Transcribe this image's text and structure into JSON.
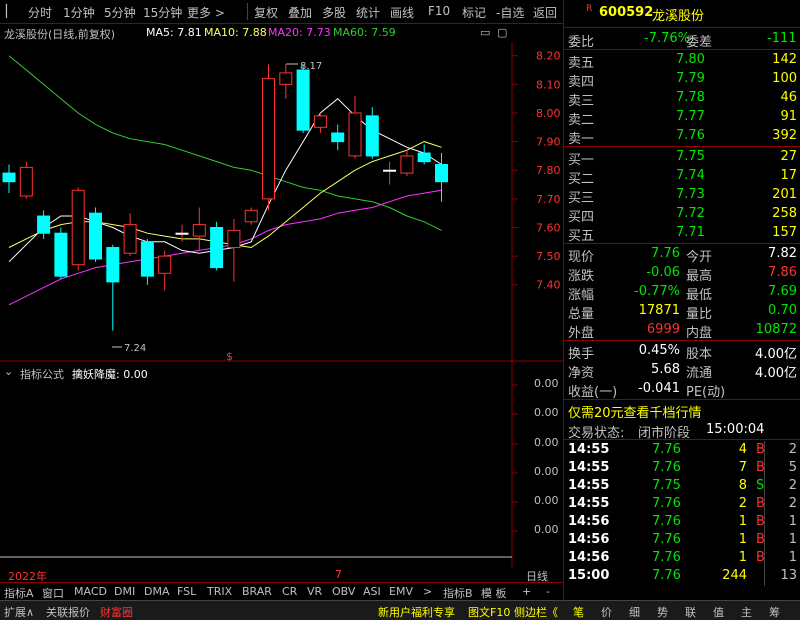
{
  "toolbar": {
    "items": [
      "分时",
      "1分钟",
      "5分钟",
      "15分钟",
      "更多 >",
      "复权",
      "叠加",
      "多股",
      "统计",
      "画线",
      "F10",
      "标记",
      "-自选",
      "返回"
    ]
  },
  "chart_header": {
    "stock": "龙溪股份(日线,前复权)",
    "ma5": "MA5: 7.81",
    "ma10": "MA10: 7.88",
    "ma20": "MA20: 7.73",
    "ma60": "MA60: 7.59"
  },
  "main_chart": {
    "y_ticks": [
      "8.20",
      "8.10",
      "8.00",
      "7.90",
      "7.80",
      "7.70",
      "7.60",
      "7.50",
      "7.40"
    ],
    "high_label": "8.17",
    "low_label": "7.24",
    "marker": "$"
  },
  "chart_data": {
    "type": "candlestick",
    "ylim": [
      7.2,
      8.22
    ],
    "candles": [
      {
        "o": 7.79,
        "c": 7.76,
        "h": 7.82,
        "l": 7.72
      },
      {
        "o": 7.71,
        "c": 7.81,
        "h": 7.83,
        "l": 7.7
      },
      {
        "o": 7.64,
        "c": 7.58,
        "h": 7.66,
        "l": 7.56
      },
      {
        "o": 7.58,
        "c": 7.43,
        "h": 7.6,
        "l": 7.42
      },
      {
        "o": 7.47,
        "c": 7.73,
        "h": 7.74,
        "l": 7.45
      },
      {
        "o": 7.65,
        "c": 7.49,
        "h": 7.67,
        "l": 7.48
      },
      {
        "o": 7.53,
        "c": 7.41,
        "h": 7.54,
        "l": 7.24
      },
      {
        "o": 7.51,
        "c": 7.61,
        "h": 7.65,
        "l": 7.5
      },
      {
        "o": 7.55,
        "c": 7.43,
        "h": 7.56,
        "l": 7.4
      },
      {
        "o": 7.44,
        "c": 7.5,
        "h": 7.52,
        "l": 7.38
      },
      {
        "o": 7.58,
        "c": 7.58,
        "h": 7.61,
        "l": 7.55
      },
      {
        "o": 7.57,
        "c": 7.61,
        "h": 7.67,
        "l": 7.52
      },
      {
        "o": 7.6,
        "c": 7.46,
        "h": 7.62,
        "l": 7.45
      },
      {
        "o": 7.53,
        "c": 7.59,
        "h": 7.63,
        "l": 7.41
      },
      {
        "o": 7.62,
        "c": 7.66,
        "h": 7.67,
        "l": 7.61
      },
      {
        "o": 7.7,
        "c": 8.12,
        "h": 8.17,
        "l": 7.66
      },
      {
        "o": 8.1,
        "c": 8.14,
        "h": 8.17,
        "l": 8.05
      },
      {
        "o": 8.15,
        "c": 7.94,
        "h": 8.17,
        "l": 7.93
      },
      {
        "o": 7.95,
        "c": 7.99,
        "h": 8.0,
        "l": 7.93
      },
      {
        "o": 7.93,
        "c": 7.9,
        "h": 7.96,
        "l": 7.87
      },
      {
        "o": 7.85,
        "c": 8.0,
        "h": 8.06,
        "l": 7.84
      },
      {
        "o": 7.99,
        "c": 7.85,
        "h": 8.02,
        "l": 7.84
      },
      {
        "o": 7.8,
        "c": 7.8,
        "h": 7.83,
        "l": 7.75
      },
      {
        "o": 7.79,
        "c": 7.85,
        "h": 7.87,
        "l": 7.78
      },
      {
        "o": 7.86,
        "c": 7.83,
        "h": 7.89,
        "l": 7.82
      },
      {
        "o": 7.82,
        "c": 7.76,
        "h": 7.86,
        "l": 7.69
      }
    ],
    "ma5": [
      7.48,
      7.54,
      7.6,
      7.64,
      7.64,
      7.62,
      7.6,
      7.57,
      7.55,
      7.55,
      7.52,
      7.51,
      7.52,
      7.53,
      7.55,
      7.68,
      7.8,
      7.9,
      8.0,
      8.05,
      7.99,
      7.94,
      7.91,
      7.88,
      7.86,
      7.82
    ],
    "ma10": [
      7.53,
      7.56,
      7.59,
      7.61,
      7.62,
      7.62,
      7.61,
      7.6,
      7.58,
      7.57,
      7.56,
      7.56,
      7.55,
      7.54,
      7.53,
      7.57,
      7.62,
      7.67,
      7.72,
      7.76,
      7.8,
      7.83,
      7.85,
      7.87,
      7.9,
      7.88
    ],
    "ma20": [
      7.33,
      7.36,
      7.39,
      7.42,
      7.44,
      7.46,
      7.47,
      7.48,
      7.49,
      7.5,
      7.51,
      7.52,
      7.53,
      7.54,
      7.56,
      7.59,
      7.61,
      7.62,
      7.63,
      7.65,
      7.66,
      7.67,
      7.69,
      7.71,
      7.72,
      7.73
    ],
    "ma60": [
      8.2,
      8.15,
      8.1,
      8.05,
      8.0,
      7.96,
      7.93,
      7.91,
      7.9,
      7.89,
      7.87,
      7.85,
      7.83,
      7.81,
      7.8,
      7.78,
      7.76,
      7.74,
      7.73,
      7.71,
      7.7,
      7.69,
      7.67,
      7.64,
      7.62,
      7.59
    ]
  },
  "sub_chart": {
    "header_label": "指标公式",
    "indicator": "擒妖降魔: 0.00",
    "y_ticks": [
      "0.00",
      "0.00",
      "0.00",
      "0.00",
      "0.00",
      "0.00"
    ]
  },
  "x_axis": {
    "left": "2022年",
    "mid": "7",
    "right": "日线"
  },
  "tabs": [
    "指标A",
    "窗口",
    "MACD",
    "DMI",
    "DMA",
    "FSL",
    "TRIX",
    "BRAR",
    "CR",
    "VR",
    "OBV",
    "ASI",
    "EMV",
    ">",
    "指标B",
    "模 板",
    "+",
    "-"
  ],
  "status_bar": {
    "items": [
      "扩展∧",
      "关联报价",
      "财富圈"
    ],
    "right_items": [
      "新用户福利专享",
      "图文F10",
      "侧边栏《"
    ],
    "quick_icons": [
      "笔",
      "价",
      "细",
      "势",
      "联",
      "值",
      "主",
      "筹"
    ]
  },
  "quote": {
    "badge": "R",
    "code": "600592",
    "name": "龙溪股份",
    "weibi_label": "委比",
    "weibi": "-7.76%",
    "weicha_label": "委差",
    "weicha": "-111",
    "sells": [
      {
        "label": "卖五",
        "price": "7.80",
        "vol": "142"
      },
      {
        "label": "卖四",
        "price": "7.79",
        "vol": "100"
      },
      {
        "label": "卖三",
        "price": "7.78",
        "vol": "46"
      },
      {
        "label": "卖二",
        "price": "7.77",
        "vol": "91"
      },
      {
        "label": "卖一",
        "price": "7.76",
        "vol": "392"
      }
    ],
    "buys": [
      {
        "label": "买一",
        "price": "7.75",
        "vol": "27"
      },
      {
        "label": "买二",
        "price": "7.74",
        "vol": "17"
      },
      {
        "label": "买三",
        "price": "7.73",
        "vol": "201"
      },
      {
        "label": "买四",
        "price": "7.72",
        "vol": "258"
      },
      {
        "label": "买五",
        "price": "7.71",
        "vol": "157"
      }
    ],
    "stats": [
      {
        "l1": "现价",
        "v1": "7.76",
        "l2": "今开",
        "v2": "7.82",
        "c1": "green",
        "c2": "white"
      },
      {
        "l1": "涨跌",
        "v1": "-0.06",
        "l2": "最高",
        "v2": "7.86",
        "c1": "green",
        "c2": "red"
      },
      {
        "l1": "涨幅",
        "v1": "-0.77%",
        "l2": "最低",
        "v2": "7.69",
        "c1": "green",
        "c2": "green"
      },
      {
        "l1": "总量",
        "v1": "17871",
        "l2": "量比",
        "v2": "0.70",
        "c1": "yellow",
        "c2": "green"
      },
      {
        "l1": "外盘",
        "v1": "6999",
        "l2": "内盘",
        "v2": "10872",
        "c1": "red",
        "c2": "green"
      }
    ],
    "stats2": [
      {
        "l1": "换手",
        "v1": "0.45%",
        "l2": "股本",
        "v2": "4.00亿"
      },
      {
        "l1": "净资",
        "v1": "5.68",
        "l2": "流通",
        "v2": "4.00亿"
      },
      {
        "l1": "收益(一)",
        "v1": "-0.041",
        "l2": "PE(动)",
        "v2": ""
      }
    ],
    "promo": "仅需20元查看千档行情",
    "trade_status_label": "交易状态:",
    "trade_status": "闭市阶段",
    "trade_time": "15:00:04",
    "ticks": [
      {
        "t": "14:55",
        "p": "7.76",
        "v": "4",
        "bs": "B",
        "n": "2"
      },
      {
        "t": "14:55",
        "p": "7.76",
        "v": "7",
        "bs": "B",
        "n": "5"
      },
      {
        "t": "14:55",
        "p": "7.75",
        "v": "8",
        "bs": "S",
        "n": "2"
      },
      {
        "t": "14:55",
        "p": "7.76",
        "v": "2",
        "bs": "B",
        "n": "2"
      },
      {
        "t": "14:56",
        "p": "7.76",
        "v": "1",
        "bs": "B",
        "n": "1"
      },
      {
        "t": "14:56",
        "p": "7.76",
        "v": "1",
        "bs": "B",
        "n": "1"
      },
      {
        "t": "14:56",
        "p": "7.76",
        "v": "1",
        "bs": "B",
        "n": "1"
      },
      {
        "t": "15:00",
        "p": "7.76",
        "v": "244",
        "bs": "",
        "n": "13"
      }
    ]
  },
  "colors": {
    "up": "#ff3232",
    "down": "#00ffff",
    "ma5": "#ffffff",
    "ma10": "#ffff66",
    "ma20": "#ff33ff",
    "ma60": "#33cc33",
    "frame": "#8b0000"
  }
}
